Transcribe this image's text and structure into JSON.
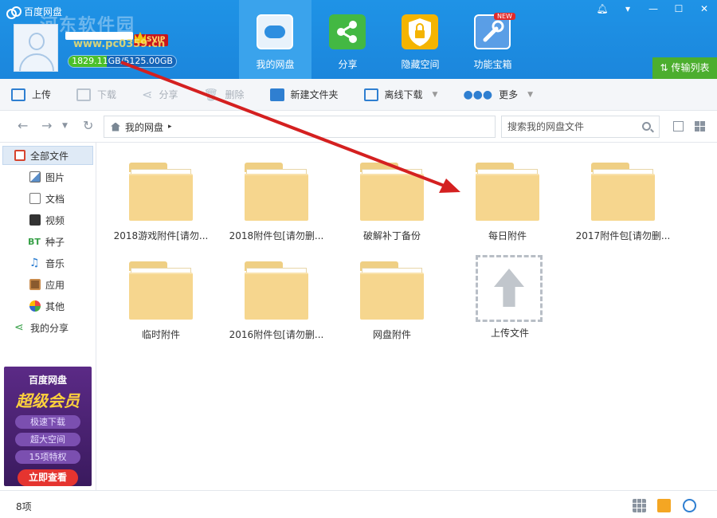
{
  "window": {
    "title": "百度网盘",
    "watermark": "河东软件园",
    "watermark_url": "www.pc0359.cn",
    "controls": [
      "bell-icon",
      "dropdown-icon",
      "minimize-icon",
      "maximize-icon",
      "close-icon"
    ]
  },
  "account": {
    "vip_badge": "SVIP",
    "quota_used": "1829.11",
    "quota_total": "GB/5125.00GB",
    "quota_text": "1829.11GB/5125.00GB",
    "quota_fraction": 0.357
  },
  "nav": {
    "tabs": [
      {
        "label": "我的网盘",
        "icon": "cloud-disk-icon",
        "active": true
      },
      {
        "label": "分享",
        "icon": "share-icon",
        "active": false
      },
      {
        "label": "隐藏空间",
        "icon": "lock-icon",
        "active": false
      },
      {
        "label": "功能宝箱",
        "icon": "toolbox-icon",
        "active": false
      }
    ],
    "new_badge": "NEW",
    "transfer_list": "传输列表"
  },
  "toolbar": {
    "upload": "上传",
    "download": "下载",
    "share": "分享",
    "delete": "删除",
    "new_folder": "新建文件夹",
    "offline_download": "离线下载",
    "more": "更多"
  },
  "address": {
    "breadcrumb_root": "我的网盘",
    "breadcrumb_sep": "▸",
    "search_placeholder": "搜索我的网盘文件"
  },
  "sidebar": {
    "items": [
      {
        "label": "全部文件",
        "icon": "all-files-icon",
        "active": true
      },
      {
        "label": "图片",
        "icon": "image-icon"
      },
      {
        "label": "文档",
        "icon": "document-icon"
      },
      {
        "label": "视频",
        "icon": "video-icon"
      },
      {
        "label": "种子",
        "icon": "bt-icon"
      },
      {
        "label": "音乐",
        "icon": "music-icon"
      },
      {
        "label": "应用",
        "icon": "app-icon"
      },
      {
        "label": "其他",
        "icon": "other-icon"
      },
      {
        "label": "我的分享",
        "icon": "my-share-icon"
      }
    ],
    "promo": {
      "brand": "百度网盘",
      "title": "超级会员",
      "features": [
        "极速下载",
        "超大空间",
        "15项特权"
      ],
      "cta": "立即查看"
    }
  },
  "files": [
    {
      "name": "2018游戏附件[请勿...",
      "type": "folder"
    },
    {
      "name": "2018附件包[请勿删...",
      "type": "folder"
    },
    {
      "name": "破解补丁备份",
      "type": "folder"
    },
    {
      "name": "每日附件",
      "type": "folder"
    },
    {
      "name": "2017附件包[请勿删...",
      "type": "folder"
    },
    {
      "name": "临时附件",
      "type": "folder"
    },
    {
      "name": "2016附件包[请勿删...",
      "type": "folder"
    },
    {
      "name": "网盘附件",
      "type": "folder"
    },
    {
      "name": "上传文件",
      "type": "upload"
    }
  ],
  "status": {
    "count": "8项"
  },
  "colors": {
    "header_blue": "#1f93e6",
    "active_tab": "#3aa3ec",
    "transfer_green": "#4cae2e",
    "folder": "#f6d68e",
    "annotation_arrow": "#d42020"
  }
}
